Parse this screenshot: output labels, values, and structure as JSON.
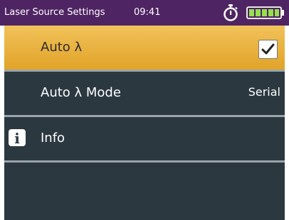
{
  "status_bar": {
    "title": "Laser Source Settings",
    "time": "09:41",
    "icons": [
      "stopwatch-icon",
      "battery-icon"
    ]
  },
  "menu": {
    "items": [
      {
        "label": "Auto λ",
        "checked": true,
        "selected": true,
        "icon": "checkbox-check-icon"
      },
      {
        "label": "Auto λ Mode",
        "value": "Serial"
      },
      {
        "label": "Info",
        "icon": "info-icon",
        "icon_text": "i"
      }
    ]
  },
  "colors": {
    "status_bar_bg": "#4f2463",
    "menu_bg": "#2b3840",
    "selected_item": "#e8b13f",
    "divider": "#9ba4ab",
    "battery": "#95e14b"
  }
}
